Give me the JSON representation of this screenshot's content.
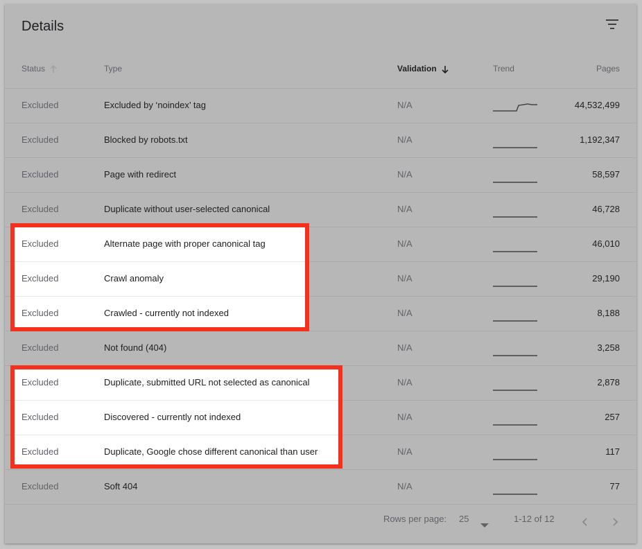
{
  "card": {
    "title": "Details",
    "filter_icon": "filter-icon"
  },
  "columns": {
    "status": "Status",
    "type": "Type",
    "validation": "Validation",
    "trend": "Trend",
    "pages": "Pages"
  },
  "rows": [
    {
      "status": "Excluded",
      "type": "Excluded by ‘noindex’ tag",
      "validation": "N/A",
      "pages": "44,532,499",
      "trend": "step-up"
    },
    {
      "status": "Excluded",
      "type": "Blocked by robots.txt",
      "validation": "N/A",
      "pages": "1,192,347",
      "trend": "flat"
    },
    {
      "status": "Excluded",
      "type": "Page with redirect",
      "validation": "N/A",
      "pages": "58,597",
      "trend": "flat"
    },
    {
      "status": "Excluded",
      "type": "Duplicate without user-selected canonical",
      "validation": "N/A",
      "pages": "46,728",
      "trend": "flat"
    },
    {
      "status": "Excluded",
      "type": "Alternate page with proper canonical tag",
      "validation": "N/A",
      "pages": "46,010",
      "trend": "flat"
    },
    {
      "status": "Excluded",
      "type": "Crawl anomaly",
      "validation": "N/A",
      "pages": "29,190",
      "trend": "flat"
    },
    {
      "status": "Excluded",
      "type": "Crawled - currently not indexed",
      "validation": "N/A",
      "pages": "8,188",
      "trend": "flat"
    },
    {
      "status": "Excluded",
      "type": "Not found (404)",
      "validation": "N/A",
      "pages": "3,258",
      "trend": "flat"
    },
    {
      "status": "Excluded",
      "type": "Duplicate, submitted URL not selected as canonical",
      "validation": "N/A",
      "pages": "2,878",
      "trend": "flat"
    },
    {
      "status": "Excluded",
      "type": "Discovered - currently not indexed",
      "validation": "N/A",
      "pages": "257",
      "trend": "flat"
    },
    {
      "status": "Excluded",
      "type": "Duplicate, Google chose different canonical than user",
      "validation": "N/A",
      "pages": "117",
      "trend": "flat"
    },
    {
      "status": "Excluded",
      "type": "Soft 404",
      "validation": "N/A",
      "pages": "77",
      "trend": "flat"
    }
  ],
  "footer": {
    "rows_per_page_label": "Rows per page:",
    "rows_per_page_value": "25",
    "range": "1-12 of 12"
  },
  "colors": {
    "highlight": "#f5301b"
  }
}
